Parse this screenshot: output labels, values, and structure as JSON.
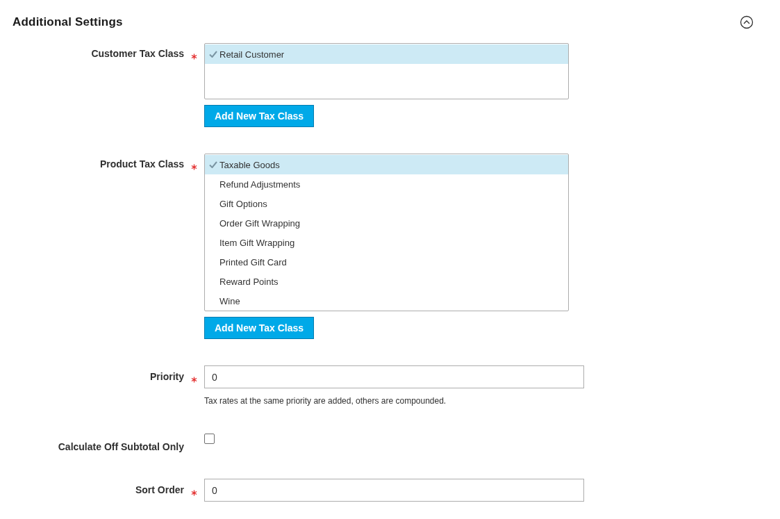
{
  "section": {
    "title": "Additional Settings",
    "expanded": true
  },
  "fields": [
    {
      "kind": "multiselect",
      "label": "Customer Tax Class",
      "required": true,
      "options": [
        {
          "label": "Retail Customer",
          "selected": true
        }
      ],
      "button": "Add New Tax Class"
    },
    {
      "kind": "multiselect",
      "label": "Product Tax Class",
      "required": true,
      "options": [
        {
          "label": "Taxable Goods",
          "selected": true
        },
        {
          "label": "Refund Adjustments",
          "selected": false
        },
        {
          "label": "Gift Options",
          "selected": false
        },
        {
          "label": "Order Gift Wrapping",
          "selected": false
        },
        {
          "label": "Item Gift Wrapping",
          "selected": false
        },
        {
          "label": "Printed Gift Card",
          "selected": false
        },
        {
          "label": "Reward Points",
          "selected": false
        },
        {
          "label": "Wine",
          "selected": false
        }
      ],
      "button": "Add New Tax Class"
    },
    {
      "kind": "text",
      "label": "Priority",
      "required": true,
      "value": "0",
      "note": "Tax rates at the same priority are added, others are compounded."
    },
    {
      "kind": "checkbox",
      "label": "Calculate Off Subtotal Only",
      "required": false,
      "checked": false
    },
    {
      "kind": "text",
      "label": "Sort Order",
      "required": true,
      "value": "0"
    }
  ]
}
